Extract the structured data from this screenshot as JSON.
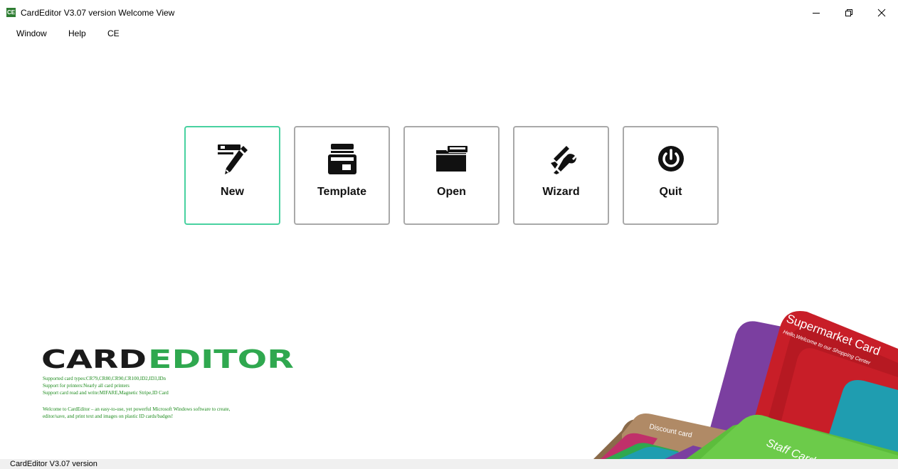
{
  "window": {
    "title": "CardEditor V3.07 version  Welcome View",
    "app_icon_text": "CE"
  },
  "menu": {
    "items": [
      "Window",
      "Help",
      "CE"
    ]
  },
  "tiles": [
    {
      "label": "New",
      "icon": "pen-card-icon",
      "active": true
    },
    {
      "label": "Template",
      "icon": "template-card-icon",
      "active": false
    },
    {
      "label": "Open",
      "icon": "folder-icon",
      "active": false
    },
    {
      "label": "Wizard",
      "icon": "tools-icon",
      "active": false
    },
    {
      "label": "Quit",
      "icon": "power-icon",
      "active": false
    }
  ],
  "logo": {
    "part1": "CARD",
    "part2": "EDITOR",
    "info": [
      "Supported card types:CR79,CR80,CR90,CR100,ID2,ID3,IDn",
      "Support for printers:Nearly all card printers",
      "Support card read and write:MIFARE,Magnetic Stripe,ID Card",
      "Welcome to CardEditor – an easy-to-use, yet powerful Microsoft Windows software to create,",
      "editor/save, and print text and images on plastic ID cards/badges!"
    ]
  },
  "cards": {
    "supermarket_title": "Supermarket Card",
    "supermarket_sub": "Hello,Welcome to our Shopping Center",
    "discount": "Discount card",
    "staff": "Staff Card"
  },
  "status": {
    "text": "CardEditor V3.07 version"
  },
  "colors": {
    "accent_border": "#48d1a0",
    "logo_dark": "#1a1a1a",
    "logo_green": "#2fa84f",
    "info_green": "#1b8a1b"
  }
}
